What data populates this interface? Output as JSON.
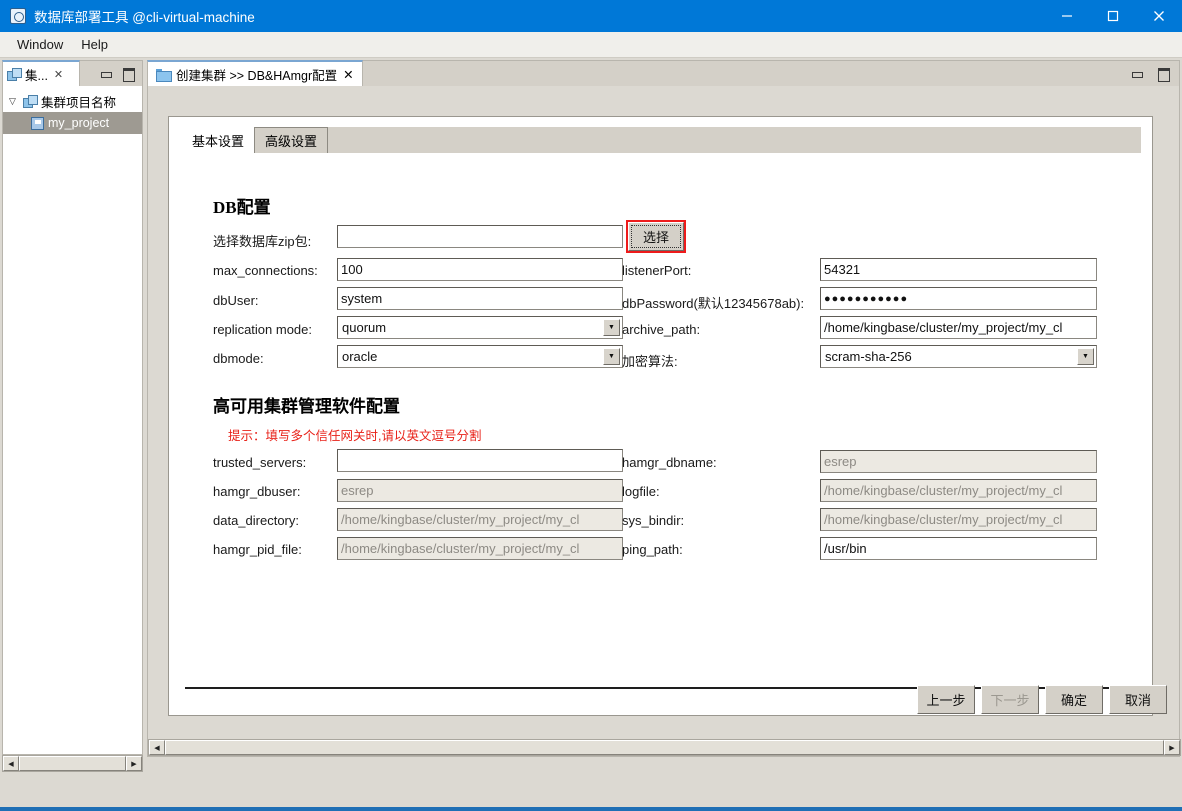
{
  "window": {
    "title": "数据库部署工具 @cli-virtual-machine",
    "icon": "app-icon",
    "controls": {
      "minimize": "—",
      "maximize": "□",
      "close": "✕"
    }
  },
  "menubar": {
    "items": [
      {
        "label": "Window",
        "mnemonic": "W"
      },
      {
        "label": "Help",
        "mnemonic": "H"
      }
    ]
  },
  "left_view": {
    "tab": {
      "label": "集...",
      "close": "✕"
    },
    "buttons": {
      "minimize": "minimize-icon",
      "maximize": "maximize-icon"
    },
    "tree": {
      "root": {
        "label": "集群项目名称",
        "twisty": "▽"
      },
      "children": [
        {
          "label": "my_project",
          "selected": true
        }
      ]
    }
  },
  "editor": {
    "tab": {
      "label": "创建集群 >> DB&HAmgr配置",
      "close": "✕"
    },
    "buttons": {
      "minimize": "minimize-icon",
      "maximize": "maximize-icon"
    },
    "tabs": [
      {
        "label": "基本设置",
        "active": true
      },
      {
        "label": "高级设置",
        "active": false
      }
    ],
    "db_section": {
      "title": "DB配置",
      "fields": {
        "zip_label": "选择数据库zip包:",
        "zip_value": "",
        "pick_button": "选择",
        "max_connections_label": "max_connections:",
        "max_connections_value": "100",
        "listener_port_label": "listenerPort:",
        "listener_port_value": "54321",
        "dbuser_label": "dbUser:",
        "dbuser_value": "system",
        "dbpassword_label": "dbPassword(默认12345678ab):",
        "dbpassword_value": "●●●●●●●●●●●",
        "replication_mode_label": "replication mode:",
        "replication_mode_value": "quorum",
        "archive_path_label": "archive_path:",
        "archive_path_value": "/home/kingbase/cluster/my_project/my_cl",
        "dbmode_label": "dbmode:",
        "dbmode_value": "oracle",
        "encrypt_label": "加密算法:",
        "encrypt_value": "scram-sha-256"
      }
    },
    "ha_section": {
      "title": "高可用集群管理软件配置",
      "hint": "提示：填写多个信任网关时,请以英文逗号分割",
      "fields": {
        "trusted_servers_label": "trusted_servers:",
        "trusted_servers_value": "",
        "hamgr_dbname_label": "hamgr_dbname:",
        "hamgr_dbname_value": "esrep",
        "hamgr_dbuser_label": "hamgr_dbuser:",
        "hamgr_dbuser_value": "esrep",
        "logfile_label": "logfile:",
        "logfile_value": "/home/kingbase/cluster/my_project/my_cl",
        "data_directory_label": "data_directory:",
        "data_directory_value": "/home/kingbase/cluster/my_project/my_cl",
        "sys_bindir_label": "sys_bindir:",
        "sys_bindir_value": "/home/kingbase/cluster/my_project/my_cl",
        "hamgr_pid_file_label": "hamgr_pid_file:",
        "hamgr_pid_file_value": "/home/kingbase/cluster/my_project/my_cl",
        "ping_path_label": "ping_path:",
        "ping_path_value": "/usr/bin"
      }
    }
  },
  "dialog_buttons": [
    {
      "label": "上一步",
      "disabled": false
    },
    {
      "label": "下一步",
      "disabled": true
    },
    {
      "label": "确定",
      "disabled": false
    },
    {
      "label": "取消",
      "disabled": false
    }
  ],
  "colors": {
    "titlebar": "#0078d7",
    "accent_red": "#e8231a",
    "selection": "#9e9a92",
    "surface": "#d4d0c8"
  }
}
